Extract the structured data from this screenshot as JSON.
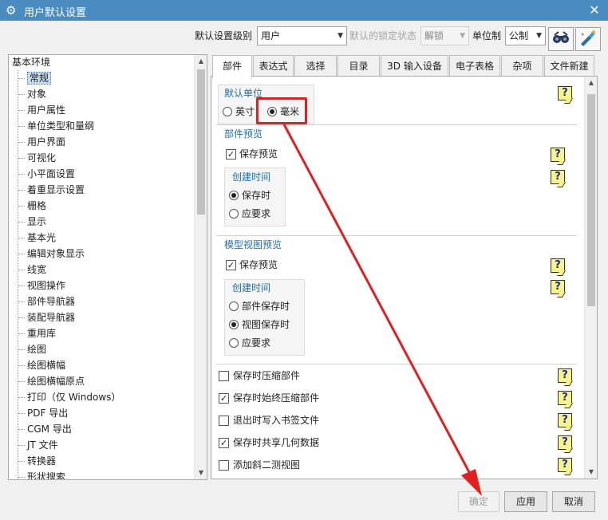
{
  "window": {
    "title": "用户默认设置"
  },
  "toolbar": {
    "level_label": "默认设置级别",
    "level_value": "用户",
    "lock_label": "默认的锁定状态",
    "lock_value": "解锁",
    "units_label": "单位制",
    "units_value": "公制"
  },
  "tree": {
    "root": "基本环境",
    "items": [
      "常规",
      "对象",
      "用户属性",
      "单位类型和量纲",
      "用户界面",
      "可视化",
      "小平面设置",
      "着重显示设置",
      "栅格",
      "显示",
      "基本光",
      "编辑对象显示",
      "线宽",
      "视图操作",
      "部件导航器",
      "装配导航器",
      "重用库",
      "绘图",
      "绘图横幅",
      "绘图横幅原点",
      "打印（仅 Windows）",
      "PDF 导出",
      "CGM 导出",
      "JT 文件",
      "转换器",
      "形状搜索"
    ],
    "selected_index": 0
  },
  "tabs": [
    "部件",
    "表达式",
    "选择",
    "目录",
    "3D 输入设备",
    "电子表格",
    "杂项",
    "文件新建"
  ],
  "active_tab_index": 0,
  "default_units": {
    "title": "默认单位",
    "options": [
      "英寸",
      "毫米"
    ],
    "selected": "毫米"
  },
  "part_preview": {
    "title": "部件预览",
    "save_preview_label": "保存预览",
    "save_preview_checked": true,
    "create_time_title": "创建时间",
    "options": [
      "保存时",
      "应要求"
    ],
    "selected": "保存时"
  },
  "model_view_preview": {
    "title": "模型视图预览",
    "save_preview_label": "保存预览",
    "save_preview_checked": true,
    "create_time_title": "创建时间",
    "options": [
      "部件保存时",
      "视图保存时",
      "应要求"
    ],
    "selected": "视图保存时"
  },
  "misc_options": [
    {
      "label": "保存时压缩部件",
      "checked": false
    },
    {
      "label": "保存时始终压缩部件",
      "checked": true
    },
    {
      "label": "退出时写入书签文件",
      "checked": false
    },
    {
      "label": "保存时共享几何数据",
      "checked": true
    },
    {
      "label": "添加斜二测视图",
      "checked": false
    }
  ],
  "help_glyph": "?",
  "buttons": {
    "ok": "确定",
    "apply": "应用",
    "cancel": "取消"
  },
  "colors": {
    "titlebar": "#4a8cc0",
    "group_title": "#1f6fa8",
    "highlight": "#e02020",
    "help_bg": "#f7f48a"
  },
  "icons": [
    "gear-icon",
    "close-icon",
    "dropdown-arrow-icon",
    "glasses-icon",
    "magic-wand-icon",
    "help-icon",
    "scroll-up-icon",
    "scroll-down-icon"
  ]
}
